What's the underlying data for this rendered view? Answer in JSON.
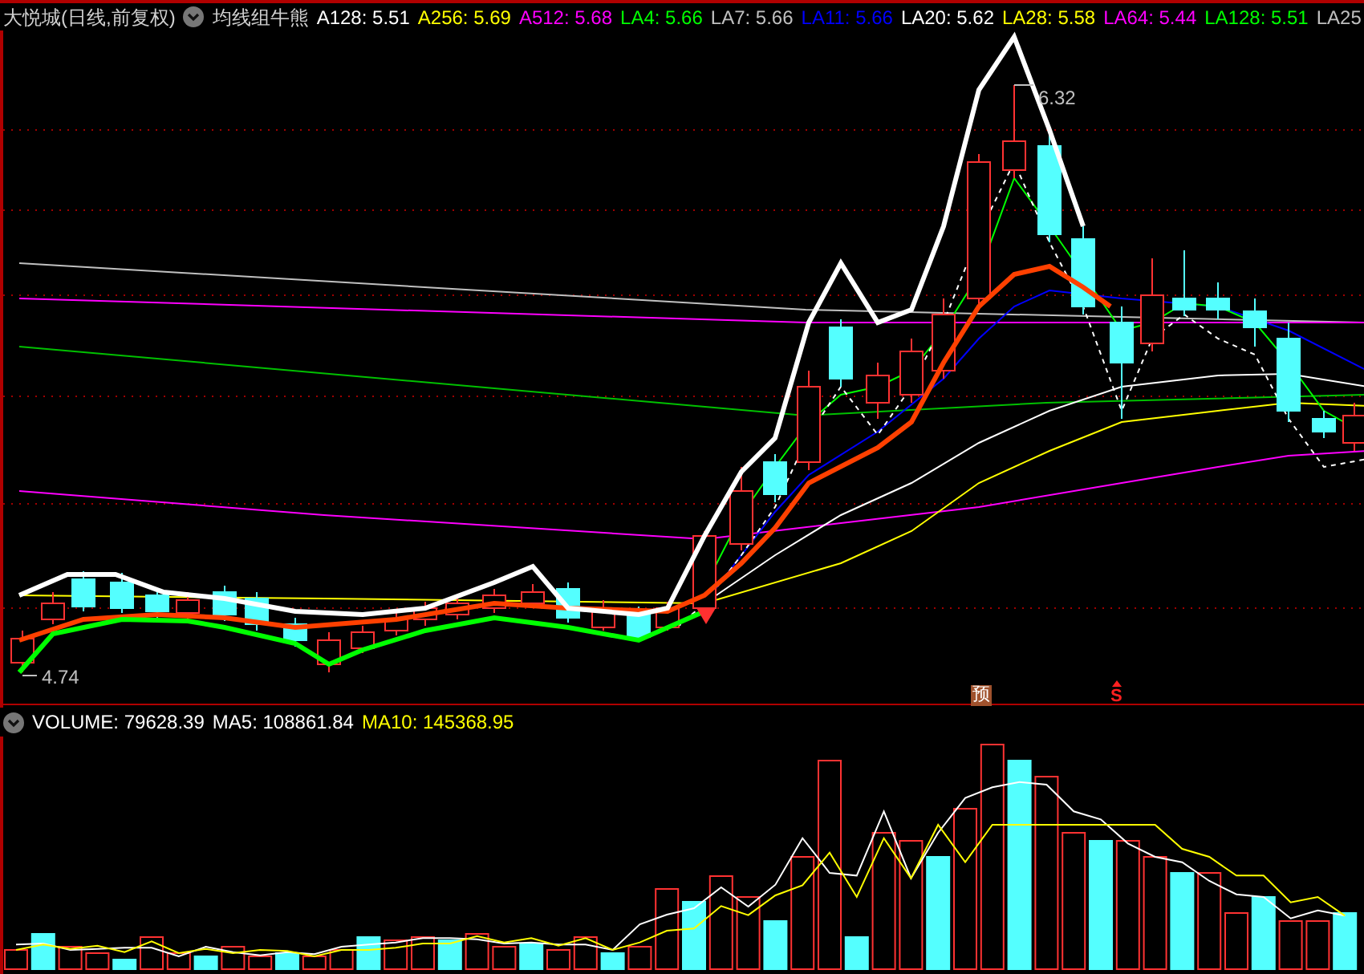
{
  "header": {
    "title": "大悦城(日线,前复权)",
    "indicator": "均线组牛熊",
    "legend": [
      {
        "label": "A128: 5.51",
        "color": "#ffffff"
      },
      {
        "label": "A256: 5.69",
        "color": "#ffff00"
      },
      {
        "label": "A512: 5.68",
        "color": "#ff00ff"
      },
      {
        "label": "LA4: 5.66",
        "color": "#00ff00"
      },
      {
        "label": "LA7: 5.66",
        "color": "#c0c0c0"
      },
      {
        "label": "LA11: 5.66",
        "color": "#0000ff"
      },
      {
        "label": "LA20: 5.62",
        "color": "#ffffff"
      },
      {
        "label": "LA28: 5.58",
        "color": "#ffff00"
      },
      {
        "label": "LA64: 5.44",
        "color": "#ff00ff"
      },
      {
        "label": "LA128: 5.51",
        "color": "#00ff00"
      },
      {
        "label": "LA25",
        "color": "#c0c0c0"
      }
    ]
  },
  "price_chart": {
    "high_label": "6.32",
    "low_label": "4.74",
    "signals": [
      {
        "kind": "forecast",
        "text": "预"
      },
      {
        "kind": "sell",
        "text": "S"
      }
    ]
  },
  "volume": {
    "legend": [
      {
        "label": "VOLUME: 79628.39",
        "color": "#ffffff"
      },
      {
        "label": "MA5: 108861.84",
        "color": "#ffffff"
      },
      {
        "label": "MA10: 145368.95",
        "color": "#ffff00"
      }
    ]
  }
}
